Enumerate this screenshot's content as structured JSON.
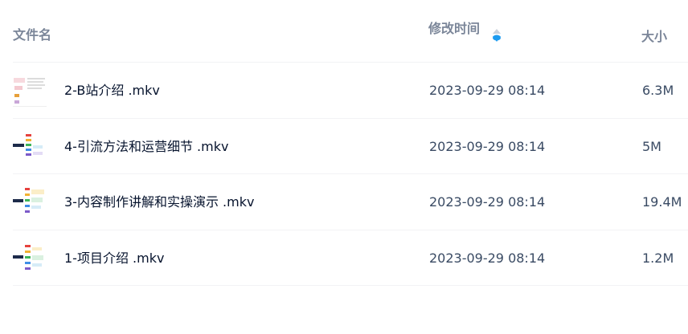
{
  "columns": {
    "name": "文件名",
    "time": "修改时间",
    "size": "大小"
  },
  "sort_icon": "sort-desc-icon",
  "colors": {
    "header_text": "#7b8699",
    "name_text": "#06132d",
    "meta_text": "#394a63",
    "sort_active": "#1c9bf0",
    "divider": "#f2f3f5"
  },
  "files": [
    {
      "name": "2-B站介绍 .mkv",
      "modified": "2023-09-29 08:14",
      "size": "6.3M"
    },
    {
      "name": "4-引流方法和运营细节 .mkv",
      "modified": "2023-09-29 08:14",
      "size": "5M"
    },
    {
      "name": "3-内容制作讲解和实操演示 .mkv",
      "modified": "2023-09-29 08:14",
      "size": "19.4M"
    },
    {
      "name": "1-项目介绍 .mkv",
      "modified": "2023-09-29 08:14",
      "size": "1.2M"
    }
  ]
}
